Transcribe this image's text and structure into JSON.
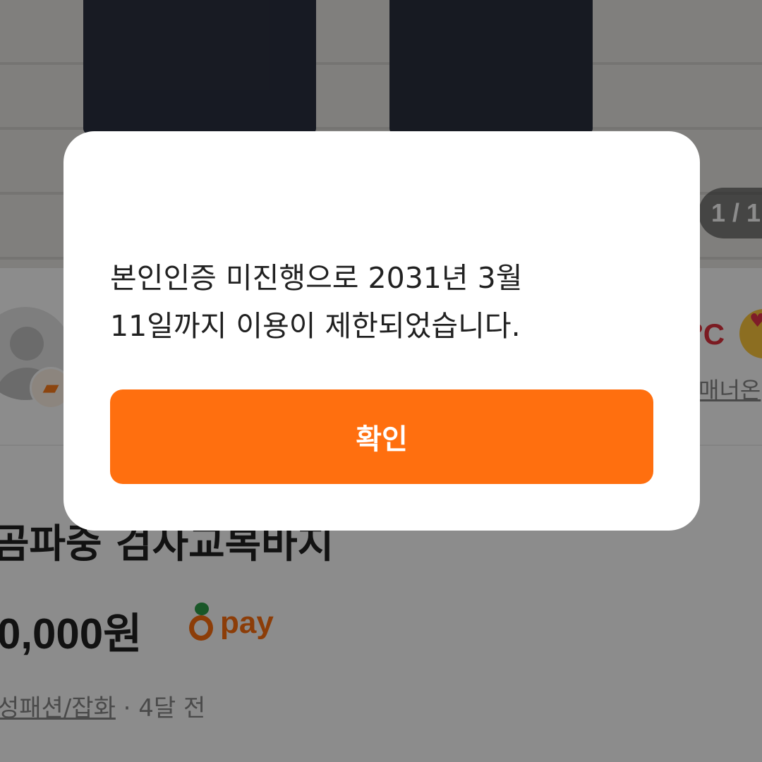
{
  "photo": {
    "counter": "1 / 1"
  },
  "seller": {
    "manner_temp": "°C",
    "manner_label": "매너온"
  },
  "product": {
    "title": "곰파중 검사교복바지",
    "price": "0,000원",
    "pay_label": "pay",
    "category": "성패션/잡화",
    "separator": " · ",
    "time_ago": "4달 전"
  },
  "dialog": {
    "message_line1": "본인인증 미진행으로 2031년 3월",
    "message_line2": "11일까지 이용이 제한되었습니다.",
    "confirm_label": "확인"
  },
  "colors": {
    "accent": "#ff6f0f",
    "overlay": "rgba(0,0,0,0.45)"
  }
}
